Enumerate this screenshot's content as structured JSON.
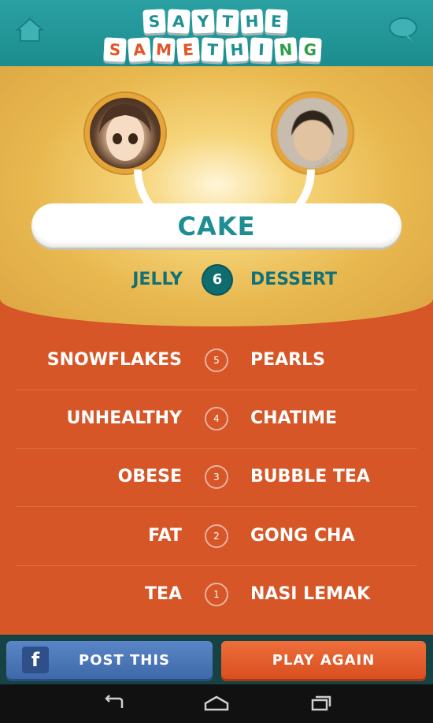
{
  "header": {
    "logo_line1": [
      "S",
      "A",
      "Y",
      "T",
      "H",
      "E"
    ],
    "logo_line2": [
      "S",
      "A",
      "M",
      "E",
      "T",
      "H",
      "I",
      "N",
      "G"
    ],
    "logo_colors": {
      "teal": "#1e8f92",
      "orange": "#e1552a",
      "green": "#2f9e4a"
    },
    "home_icon": "home-icon",
    "chat_icon": "chat-bubble-icon"
  },
  "current": {
    "answer": "CAKE",
    "left_word": "JELLY",
    "right_word": "DESSERT",
    "round": "6"
  },
  "players": {
    "right_watermark": "CHEE LOONG"
  },
  "history": [
    {
      "left": "SNOWFLAKES",
      "round": "5",
      "right": "PEARLS"
    },
    {
      "left": "UNHEALTHY",
      "round": "4",
      "right": "CHATIME"
    },
    {
      "left": "OBESE",
      "round": "3",
      "right": "BUBBLE TEA"
    },
    {
      "left": "FAT",
      "round": "2",
      "right": "GONG CHA"
    },
    {
      "left": "TEA",
      "round": "1",
      "right": "NASI LEMAK"
    }
  ],
  "buttons": {
    "post": "POST THIS",
    "post_icon_letter": "f",
    "play": "PLAY AGAIN"
  },
  "nav": {
    "back_icon": "back-icon",
    "home_icon": "home-nav-icon",
    "recents_icon": "recent-apps-icon"
  }
}
